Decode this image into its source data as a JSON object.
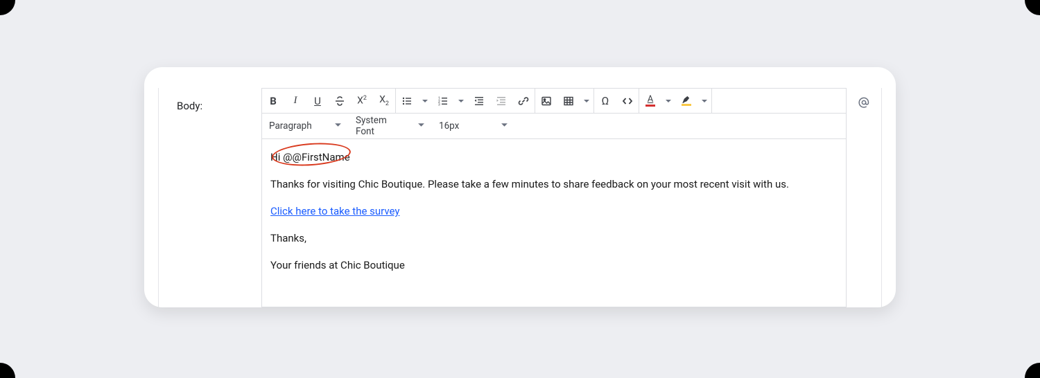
{
  "label": "Body:",
  "toolbar": {
    "block_format": "Paragraph",
    "font_family": "System Font",
    "font_size": "16px"
  },
  "content": {
    "line1_pre": "Hi ",
    "line1_token": "@@FirstName",
    "line2": "Thanks for visiting Chic Boutique. Please take a few minutes to share feedback on your most recent visit with us.",
    "link_text": "Click here to take the survey",
    "line4": "Thanks,",
    "line5": "Your friends at Chic Boutique"
  }
}
